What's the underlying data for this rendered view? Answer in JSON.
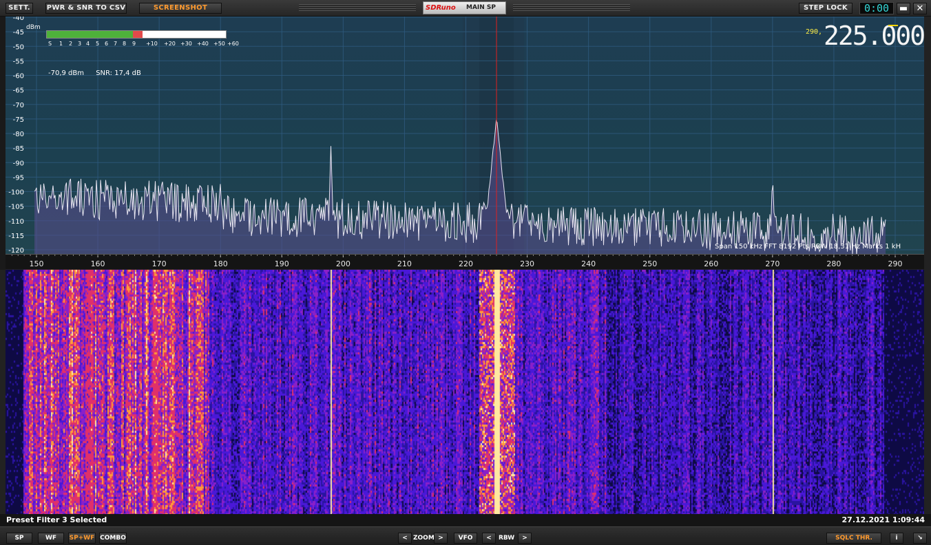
{
  "toolbar": {
    "settings_label": "SETT.",
    "export_label": "PWR & SNR TO CSV",
    "screenshot_label": "SCREENSHOT",
    "brand": "SDRuno",
    "window_title": "MAIN SP",
    "step_lock_label": "STEP LOCK",
    "step_display": "0:00",
    "minimize_label": "▬",
    "close_label": "✕"
  },
  "spectrum": {
    "unit_label": "dBm",
    "y_ticks": [
      "-40",
      "-45",
      "-50",
      "-55",
      "-60",
      "-65",
      "-70",
      "-75",
      "-80",
      "-85",
      "-90",
      "-95",
      "-100",
      "-105",
      "-110",
      "-115",
      "-120"
    ],
    "x_ticks": [
      "150",
      "160",
      "170",
      "180",
      "190",
      "200",
      "210",
      "220",
      "230",
      "240",
      "250",
      "260",
      "270",
      "280",
      "290"
    ],
    "smeter_ticks": [
      "S",
      "1",
      "2",
      "3",
      "4",
      "5",
      "6",
      "7",
      "8",
      "9",
      "+10",
      "+20",
      "+30",
      "+40",
      "+50",
      "+60"
    ],
    "smeter_level_s": 9.4,
    "power_readout": "-70,9 dBm",
    "snr_readout": "SNR: 17,4 dB",
    "vfo_prefix": "290,",
    "vfo_frequency": "225.000",
    "span_info": "Span 150 kHz  FFT 8192 Pts  RBW 18,31 Hz  Marks 1 kH",
    "colors": {
      "trace": "#e9e6f2",
      "fill": "#5a4c8e",
      "center_line": "#e02020",
      "grid": "#2f5b80"
    }
  },
  "chart_data": {
    "type": "line",
    "xlabel": "",
    "ylabel": "dBm",
    "xlim": [
      145,
      292
    ],
    "ylim": [
      -120,
      -40
    ],
    "grid": true,
    "peaks": [
      {
        "x": 225.0,
        "y": -75
      },
      {
        "x": 198.0,
        "y": -84
      },
      {
        "x": 270.0,
        "y": -92
      },
      {
        "x": 284.0,
        "y": -110
      }
    ],
    "noise_floor_start": -106,
    "noise_floor_end": -115
  },
  "status": {
    "message": "Preset Filter 3 Selected",
    "datetime": "27.12.2021 1:09:44"
  },
  "bottombar": {
    "sp_label": "SP",
    "wf_label": "WF",
    "spwf_label": "SP+WF",
    "combo_label": "COMBO",
    "zoom_prev": "<",
    "zoom_label": "ZOOM",
    "zoom_next": ">",
    "vfo_label": "VFO",
    "rbw_prev": "<",
    "rbw_label": "RBW",
    "rbw_next": ">",
    "sqlc_label": "SQLC THR.",
    "info_label": "i",
    "resize_label": "↘"
  }
}
